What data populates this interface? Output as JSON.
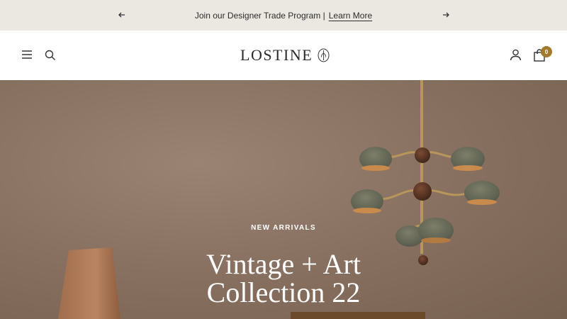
{
  "announcement": {
    "text": "Join our Designer Trade Program |",
    "link_label": "Learn More",
    "prev_icon": "arrow-left-icon",
    "next_icon": "arrow-right-icon"
  },
  "header": {
    "logo_text": "LOSTINE",
    "cart_count": "0",
    "icons": [
      "hamburger-menu-icon",
      "search-icon",
      "account-icon",
      "shopping-bag-icon"
    ]
  },
  "hero": {
    "eyebrow": "NEW ARRIVALS",
    "title_line1": "Vintage + Art",
    "title_line2": "Collection 22"
  },
  "colors": {
    "announcement_bg": "#ebe8e1",
    "hero_wall": "#8a7263",
    "badge": "#a37a2c"
  }
}
